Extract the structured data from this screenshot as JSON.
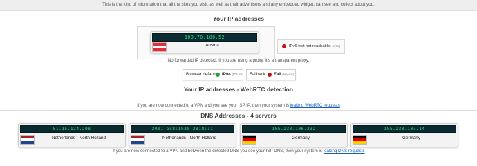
{
  "intro": "This is the kind of information that all the sites you visit, as well as their advertisers and any embedded widget, can see and collect about you.",
  "ip_section": {
    "title": "Your IP addresses",
    "ip": "109.70.100.52",
    "country": "Austria",
    "ipv6_text": "IPv6 test not reachable.",
    "ipv6_small": "(error)",
    "no_forward": "No forwarded IP detected. If you are using a proxy, it's a transparent proxy.",
    "browser_default_label": "Browser default:",
    "browser_default_value": "IPv4",
    "browser_default_small": "(505 ms)",
    "fallback_label": "Fallback:",
    "fallback_value": "Fail",
    "fallback_small": "(timeout)"
  },
  "webrtc_section": {
    "title": "Your IP addresses - WebRTC detection",
    "note": "If you are now connected to a VPN and you see your ISP IP, then your system is ",
    "link": "leaking WebRTC requests"
  },
  "dns_section": {
    "title": "DNS Addresses - 4 servers",
    "servers": [
      {
        "ip": "51.15.124.208",
        "country": "Netherlands - North Holland",
        "flag": "nl-flag-icon"
      },
      {
        "ip": "2001:bc8:1830:2818::1",
        "country": "Netherlands - North Holland",
        "flag": "nl-flag-icon"
      },
      {
        "ip": "185.233.106.232",
        "country": "Germany",
        "flag": "de-flag-icon"
      },
      {
        "ip": "185.233.107.14",
        "country": "Germany",
        "flag": "de-flag-icon"
      }
    ],
    "note": "If you are now connected to a VPN and between the detected DNS you see your ISP DNS, then your system is ",
    "link": "leaking DNS requests"
  },
  "colors": {
    "lcd_bg": "#0b2b33",
    "lcd_text": "#25e07d",
    "status_green": "#22a33a",
    "status_red": "#c0141b",
    "link": "#1a5fb4"
  }
}
